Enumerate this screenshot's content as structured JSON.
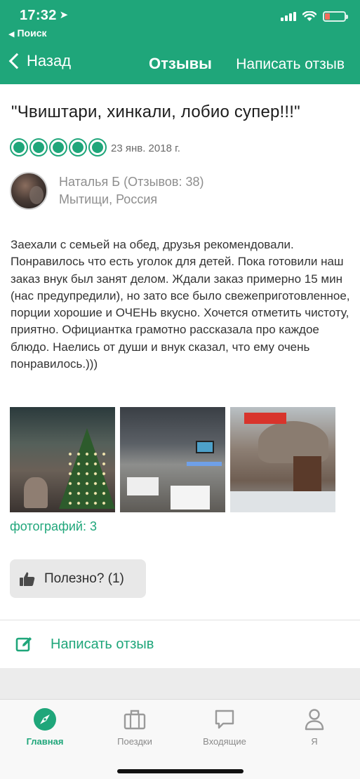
{
  "status_bar": {
    "time": "17:32",
    "back_app_label": "Поиск"
  },
  "nav": {
    "back_label": "Назад",
    "title": "Отзывы",
    "write_label": "Написать отзыв"
  },
  "review": {
    "title": "\"Чвиштари, хинкали, лобио супер!!!\"",
    "rating": 5,
    "rating_max": 5,
    "date": "23 янв. 2018 г.",
    "author": {
      "name": "Наталья Б (Отзывов: 38)",
      "location": "Мытищи, Россия"
    },
    "body": "Заехали с семьей на обед, друзья рекомендовали. Понравилось что есть уголок для детей. Пока готовили наш заказ внук был занят делом. Ждали заказ примерно 15 мин (нас предупредили), но зато все было свежеприготовленное, порции хорошие и ОЧЕНЬ вкусно. Хочется отметить чистоту, приятно. Официантка грамотно рассказала про каждое блюдо. Наелись от души и внук сказал, что ему очень понравилось.)))",
    "photos_count_label": "фотографий: 3",
    "helpful_label": "Полезно? (1)"
  },
  "write_review": {
    "label": "Написать отзыв"
  },
  "tabs": [
    {
      "label": "Главная",
      "icon": "compass-icon",
      "active": true
    },
    {
      "label": "Поездки",
      "icon": "suitcase-icon",
      "active": false
    },
    {
      "label": "Входящие",
      "icon": "chat-icon",
      "active": false
    },
    {
      "label": "Я",
      "icon": "person-icon",
      "active": false
    }
  ],
  "colors": {
    "accent": "#1fa67a",
    "battery_low": "#f36d5c"
  }
}
